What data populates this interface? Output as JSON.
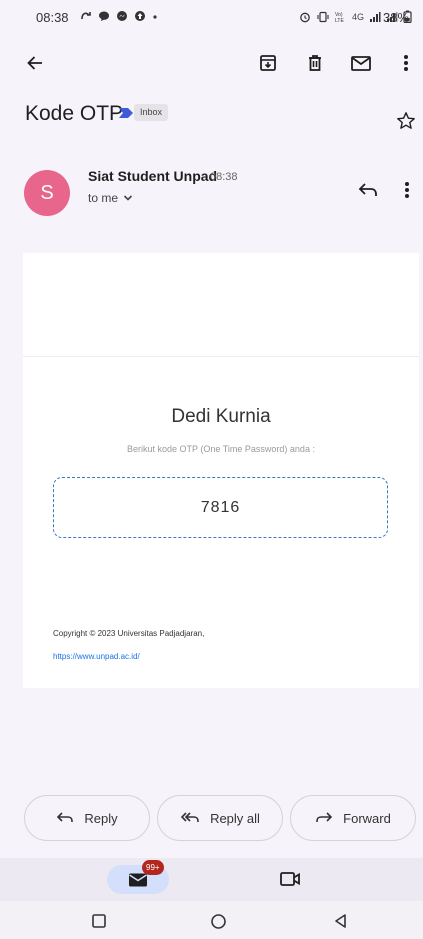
{
  "status_bar": {
    "time": "08:38",
    "network": "4G",
    "battery": "38%"
  },
  "toolbar": {
    "back": "back-arrow-icon",
    "archive": "archive-icon",
    "delete": "trash-icon",
    "mark_unread": "mail-icon",
    "more": "more-vert-icon"
  },
  "email": {
    "subject": "Kode OTP",
    "label": "Inbox",
    "sender": {
      "initial": "S",
      "name": "Siat Student Unpad",
      "time": "08:38",
      "recipient": "to me"
    },
    "body": {
      "recipient_name": "Dedi Kurnia",
      "instruction": "Berikut kode OTP (One Time Password) anda :",
      "otp_code": "7816",
      "copyright": "Copyright © 2023 Universitas Padjadjaran,",
      "link": "https://www.unpad.ac.id/"
    }
  },
  "actions": {
    "reply": "Reply",
    "reply_all": "Reply all",
    "forward": "Forward"
  },
  "bottom_tabs": {
    "mail_badge": "99+"
  },
  "colors": {
    "avatar": "#e8658b",
    "otp_border": "#3a78c7",
    "link": "#1a73e8",
    "badge": "#b3261e",
    "label_arrow": "#3f5bd6"
  }
}
